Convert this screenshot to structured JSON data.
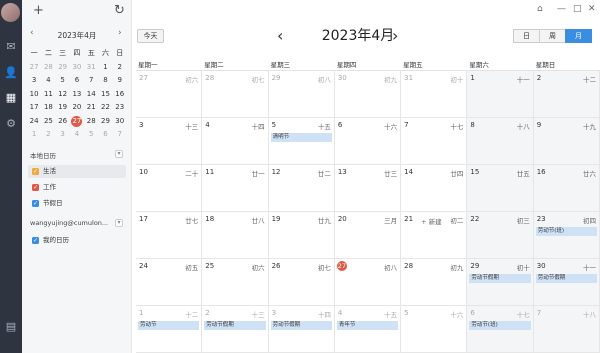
{
  "window": {
    "title": "2023年4月",
    "buttons": [
      "minimize",
      "maximize",
      "close"
    ]
  },
  "rail": {
    "icons": [
      "avatar",
      "mail-icon",
      "contacts-icon",
      "calendar-icon",
      "settings-icon",
      "notes-icon"
    ]
  },
  "sidebar": {
    "mini": {
      "title": "2023年4月",
      "weekdays": [
        "一",
        "二",
        "三",
        "四",
        "五",
        "六",
        "日"
      ],
      "weeks": [
        [
          "27",
          "28",
          "29",
          "30",
          "31",
          "1",
          "2"
        ],
        [
          "3",
          "4",
          "5",
          "6",
          "7",
          "8",
          "9"
        ],
        [
          "10",
          "11",
          "12",
          "13",
          "14",
          "15",
          "16"
        ],
        [
          "17",
          "18",
          "19",
          "20",
          "21",
          "22",
          "23"
        ],
        [
          "24",
          "25",
          "26",
          "27",
          "28",
          "29",
          "30"
        ],
        [
          "1",
          "2",
          "3",
          "4",
          "5",
          "6",
          "7"
        ]
      ]
    },
    "local_title": "本地日历",
    "local_items": [
      {
        "label": "生活",
        "color": "#f0a93a"
      },
      {
        "label": "工作",
        "color": "#e05a47"
      },
      {
        "label": "节假日",
        "color": "#3a8de0"
      }
    ],
    "account_title": "wangyujing@cumulon...",
    "account_items": [
      {
        "label": "我的日历",
        "color": "#3a8de0"
      }
    ]
  },
  "toolbar": {
    "today": "今天",
    "title": "2023年4月",
    "views": [
      "日",
      "周",
      "月"
    ],
    "active_view": "月"
  },
  "calendar": {
    "weekdays": [
      "星期一",
      "星期二",
      "星期三",
      "星期四",
      "星期五",
      "星期六",
      "星期日"
    ],
    "new_event_label": "+ 新建",
    "weeks": [
      [
        {
          "d": "27",
          "l": "初六",
          "dim": true
        },
        {
          "d": "28",
          "l": "初七",
          "dim": true
        },
        {
          "d": "29",
          "l": "初八",
          "dim": true
        },
        {
          "d": "30",
          "l": "初九",
          "dim": true
        },
        {
          "d": "31",
          "l": "初十",
          "dim": true
        },
        {
          "d": "1",
          "l": "十一"
        },
        {
          "d": "2",
          "l": "十二"
        }
      ],
      [
        {
          "d": "3",
          "l": "十三"
        },
        {
          "d": "4",
          "l": "十四"
        },
        {
          "d": "5",
          "l": "十五",
          "ev": "清明节"
        },
        {
          "d": "6",
          "l": "十六"
        },
        {
          "d": "7",
          "l": "十七"
        },
        {
          "d": "8",
          "l": "十八"
        },
        {
          "d": "9",
          "l": "十九"
        }
      ],
      [
        {
          "d": "10",
          "l": "二十"
        },
        {
          "d": "11",
          "l": "廿一"
        },
        {
          "d": "12",
          "l": "廿二"
        },
        {
          "d": "13",
          "l": "廿三"
        },
        {
          "d": "14",
          "l": "廿四"
        },
        {
          "d": "15",
          "l": "廿五"
        },
        {
          "d": "16",
          "l": "廿六"
        }
      ],
      [
        {
          "d": "17",
          "l": "廿七"
        },
        {
          "d": "18",
          "l": "廿八"
        },
        {
          "d": "19",
          "l": "廿九"
        },
        {
          "d": "20",
          "l": "三月"
        },
        {
          "d": "21",
          "l": "初二",
          "new": true
        },
        {
          "d": "22",
          "l": "初三"
        },
        {
          "d": "23",
          "l": "初四",
          "ev": "劳动节(班)"
        }
      ],
      [
        {
          "d": "24",
          "l": "初五"
        },
        {
          "d": "25",
          "l": "初六"
        },
        {
          "d": "26",
          "l": "初七"
        },
        {
          "d": "27",
          "l": "初八",
          "today": true
        },
        {
          "d": "28",
          "l": "初九"
        },
        {
          "d": "29",
          "l": "初十",
          "ev": "劳动节假期"
        },
        {
          "d": "30",
          "l": "十一",
          "ev": "劳动节假期"
        }
      ],
      [
        {
          "d": "1",
          "l": "十二",
          "dim": true,
          "ev": "劳动节"
        },
        {
          "d": "2",
          "l": "十三",
          "dim": true,
          "ev": "劳动节假期"
        },
        {
          "d": "3",
          "l": "十四",
          "dim": true,
          "ev": "劳动节假期"
        },
        {
          "d": "4",
          "l": "十五",
          "dim": true,
          "ev": "青年节"
        },
        {
          "d": "5",
          "l": "十六",
          "dim": true
        },
        {
          "d": "6",
          "l": "十七",
          "dim": true,
          "ev": "劳动节(班)"
        },
        {
          "d": "7",
          "l": "十八",
          "dim": true
        }
      ]
    ]
  }
}
